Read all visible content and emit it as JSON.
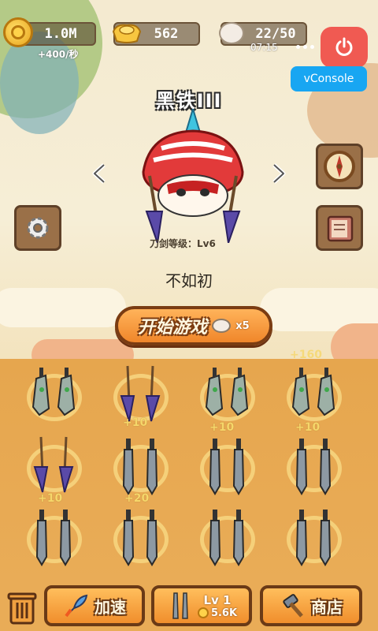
{
  "top_bar": {
    "coins": "1.0M",
    "coin_rate": "+400/秒",
    "gold": "562",
    "eggs": "22/50",
    "timer": "07:15"
  },
  "vconsole_label": "vConsole",
  "weapon": {
    "title": "黑铁III",
    "sword_level": "刀剑等级：Lv6"
  },
  "player_name": "不如初",
  "start_button": {
    "label": "开始游戏",
    "cost": "x5"
  },
  "board": {
    "top_bonus": "+160",
    "slots": [
      {
        "type": "cleaver",
        "bonus": ""
      },
      {
        "type": "spear",
        "bonus": "+10"
      },
      {
        "type": "cleaver",
        "bonus": "+10"
      },
      {
        "type": "cleaver",
        "bonus": "+10"
      },
      {
        "type": "spear",
        "bonus": "+10"
      },
      {
        "type": "blade",
        "bonus": "+20"
      },
      {
        "type": "blade",
        "bonus": ""
      },
      {
        "type": "blade",
        "bonus": ""
      },
      {
        "type": "blade",
        "bonus": ""
      },
      {
        "type": "blade",
        "bonus": ""
      },
      {
        "type": "blade",
        "bonus": ""
      },
      {
        "type": "blade",
        "bonus": ""
      }
    ]
  },
  "bottom_bar": {
    "speed_label": "加速",
    "buy_level": "Lv 1",
    "buy_cost": "5.6K",
    "shop_label": "商店"
  },
  "colors": {
    "accent_orange": "#f08e2c",
    "board": "#e6a64e",
    "vconsole": "#18a6f2",
    "power_button": "#f05a52"
  },
  "icons": [
    "coin-icon",
    "gold-ingot-icon",
    "egg-icon",
    "power-icon",
    "settings-gear-icon",
    "compass-icon",
    "book-icon",
    "trash-icon",
    "rocket-icon",
    "hammer-icon"
  ]
}
